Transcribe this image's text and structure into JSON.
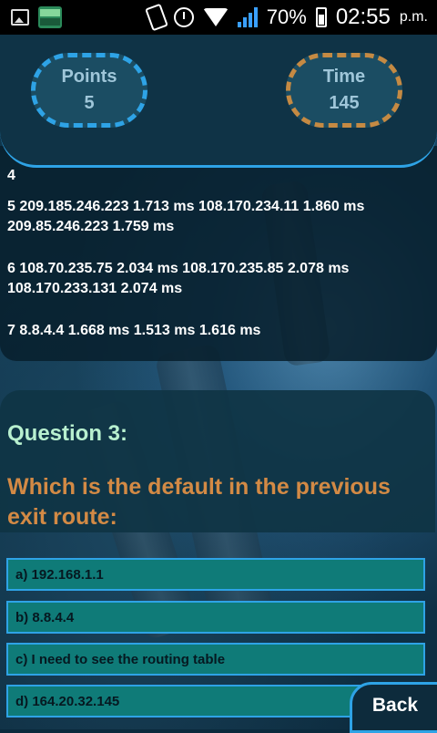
{
  "status_bar": {
    "battery": "70%",
    "time": "02:55",
    "ampm": "p.m."
  },
  "header": {
    "points_label": "Points",
    "points_value": "5",
    "time_label": "Time",
    "time_value": "145",
    "points_border_color": "#2ea3e6",
    "time_border_color": "#c58a43"
  },
  "trace": {
    "lines": [
      "4",
      "5 209.185.246.223 1.713 ms 108.170.234.11 1.860 ms 209.85.246.223 1.759 ms",
      "6 108.70.235.75 2.034 ms 108.170.235.85 2.078 ms 108.170.233.131 2.074 ms",
      "7 8.8.4.4 1.668 ms 1.513 ms 1.616 ms"
    ]
  },
  "question": {
    "title": "Question 3:",
    "text": "Which is the default in the previous exit route:"
  },
  "answers": [
    "a) 192.168.1.1",
    "b) 8.8.4.4",
    "c) I need to see the routing table",
    "d) 164.20.32.145"
  ],
  "back_label": "Back",
  "colors": {
    "accent": "#2ea3e6",
    "question_title": "#b8f0cf",
    "question_text": "#d38a45",
    "answer_bg": "#0f7b78"
  }
}
